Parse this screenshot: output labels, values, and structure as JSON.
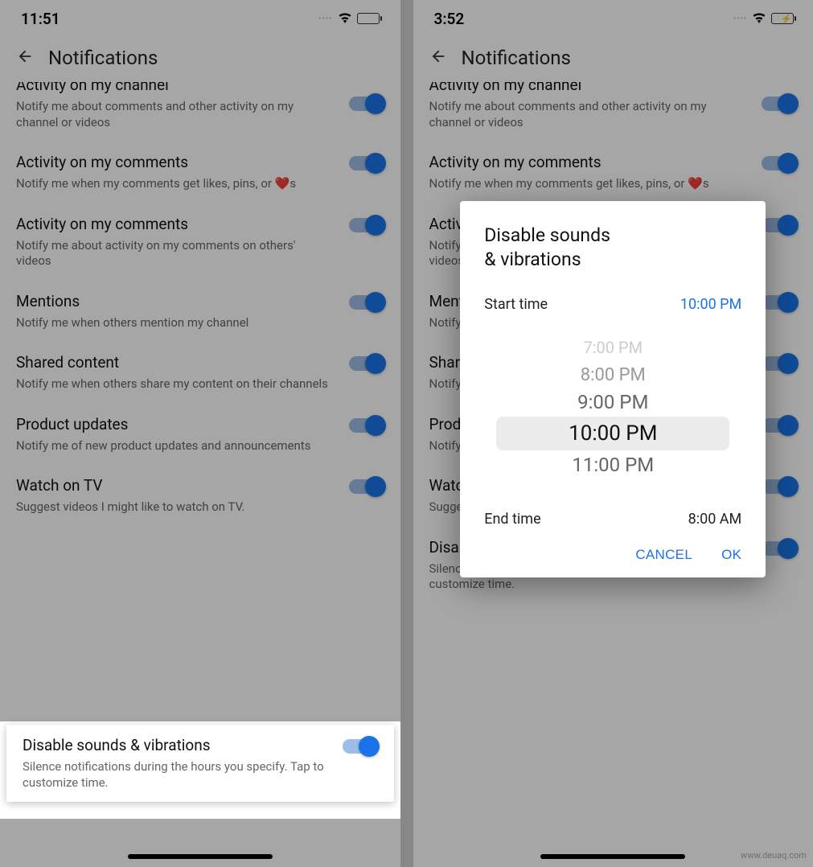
{
  "left": {
    "status": {
      "time": "11:51"
    },
    "header": {
      "title": "Notifications"
    },
    "items": [
      {
        "title": "Activity on my channel",
        "desc": "Notify me about comments and other activity on my channel or videos"
      },
      {
        "title": "Activity on my comments",
        "desc": "Notify me when my comments get likes, pins, or ❤️s"
      },
      {
        "title": "Activity on my comments",
        "desc": "Notify me about activity on my comments on others' videos"
      },
      {
        "title": "Mentions",
        "desc": "Notify me when others mention my channel"
      },
      {
        "title": "Shared content",
        "desc": "Notify me when others share my content on their channels"
      },
      {
        "title": "Product updates",
        "desc": "Notify me of new product updates and announcements"
      },
      {
        "title": "Watch on TV",
        "desc": "Suggest videos I might like to watch on TV."
      },
      {
        "title": "Disable sounds & vibrations",
        "desc": "Silence notifications during the hours you specify. Tap to customize time."
      }
    ]
  },
  "right": {
    "status": {
      "time": "3:52"
    },
    "header": {
      "title": "Notifications"
    },
    "items": [
      {
        "title": "Activity on my channel",
        "desc": "Notify me about comments and other activity on my channel or videos"
      },
      {
        "title": "Activity on my comments",
        "desc": "Notify me when my comments get likes, pins, or ❤️s"
      },
      {
        "title": "Activity on my comments",
        "desc": "Notify me about activity on my comments on others' videos"
      },
      {
        "title": "Mentions",
        "desc": "Notify me when others mention my channel"
      },
      {
        "title": "Shared content",
        "desc": "Notify me when others share my content on their channels"
      },
      {
        "title": "Product updates",
        "desc": "Notify me of new product updates and announcements"
      },
      {
        "title": "Watch on TV",
        "desc": "Suggest videos I might like to watch on TV."
      },
      {
        "title": "Disable sounds & vibrations",
        "desc": "Silence notifications during the hours you specify. Tap to customize time."
      }
    ],
    "dialog": {
      "title_line1": "Disable sounds",
      "title_line2": "& vibrations",
      "start_label": "Start time",
      "start_value": "10:00 PM",
      "end_label": "End time",
      "end_value": "8:00 AM",
      "picker": [
        "7:00 PM",
        "8:00 PM",
        "9:00 PM",
        "10:00 PM",
        "11:00 PM"
      ],
      "cancel": "CANCEL",
      "ok": "OK"
    }
  },
  "watermark": "www.deuaq.com"
}
